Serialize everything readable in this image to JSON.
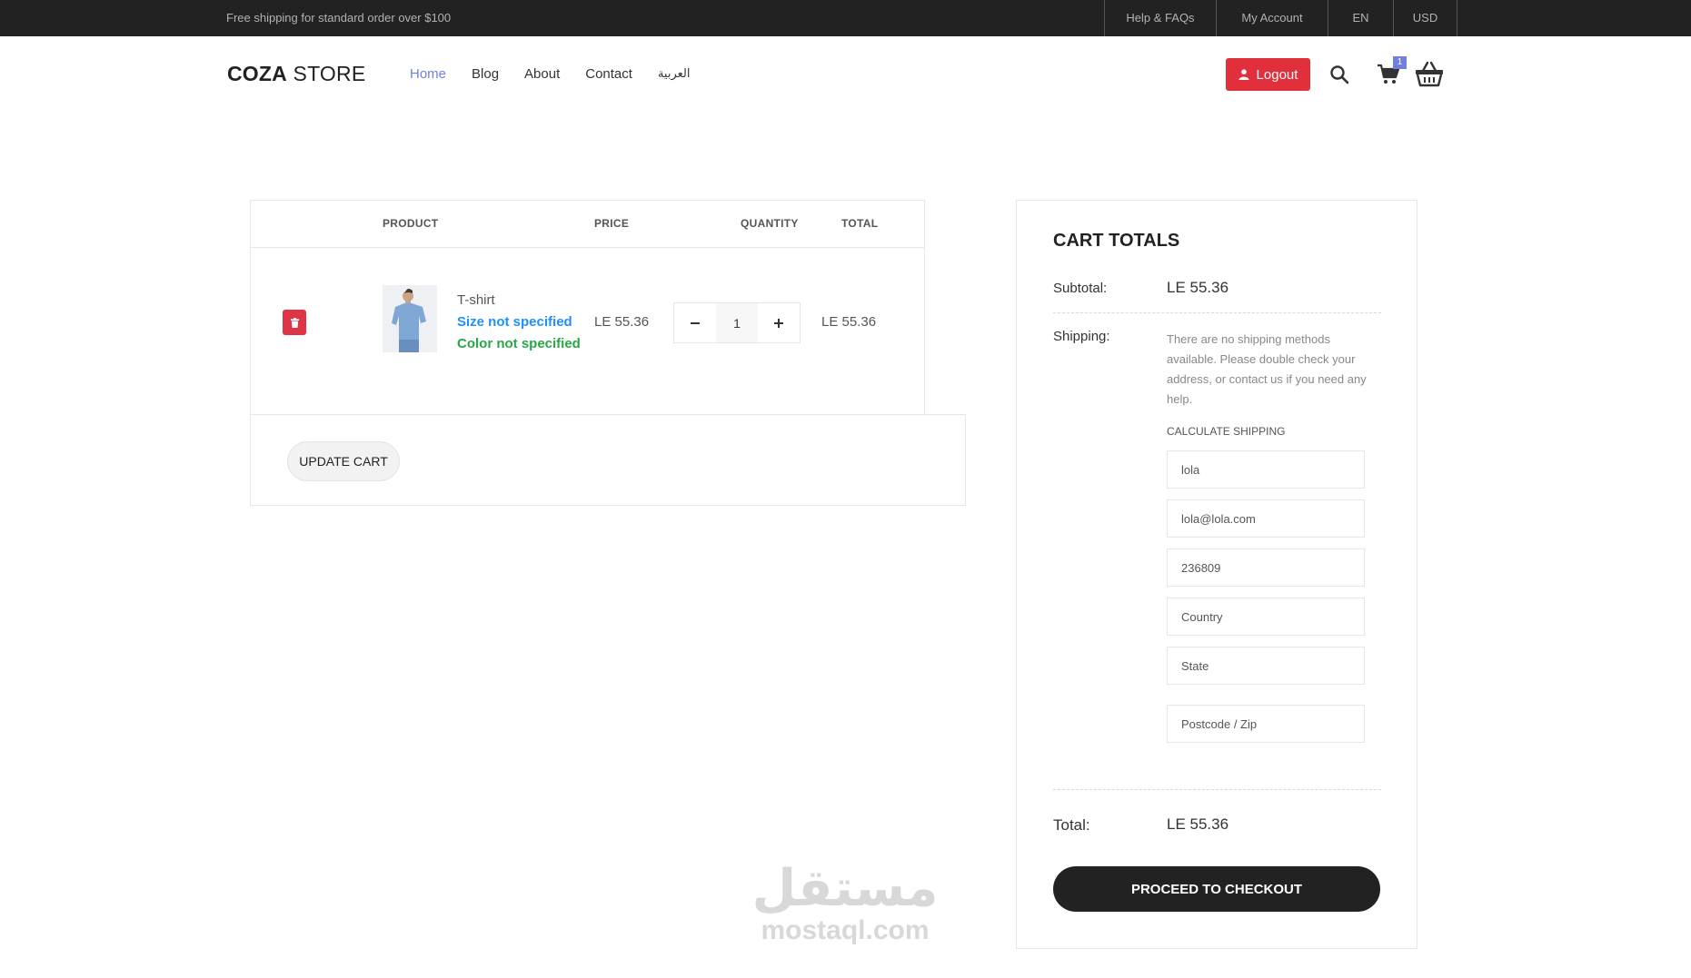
{
  "topbar": {
    "promo": "Free shipping for standard order over $100",
    "links": [
      "Help & FAQs",
      "My Account",
      "EN",
      "USD"
    ]
  },
  "header": {
    "logo_bold": "COZA",
    "logo_light": " STORE",
    "nav": [
      "Home",
      "Blog",
      "About",
      "Contact",
      "العربية"
    ],
    "active_nav": "Home",
    "logout_label": "Logout",
    "cart_count": "1"
  },
  "cart": {
    "headers": {
      "product": "PRODUCT",
      "price": "PRICE",
      "quantity": "QUANTITY",
      "total": "TOTAL"
    },
    "item": {
      "name": "T-shirt",
      "size": "Size not specified",
      "color": "Color not specified",
      "price": "LE 55.36",
      "quantity": "1",
      "total": "LE 55.36"
    },
    "update_label": "UPDATE CART"
  },
  "totals": {
    "title": "CART TOTALS",
    "subtotal_label": "Subtotal:",
    "subtotal_value": "LE 55.36",
    "shipping_label": "Shipping:",
    "shipping_text": "There are no shipping methods available. Please double check your address, or contact us if you need any help.",
    "calc_label": "CALCULATE SHIPPING",
    "fields": {
      "name": "lola",
      "email": "lola@lola.com",
      "phone": "236809",
      "country": "Country",
      "state": "State",
      "postcode": "Postcode / Zip"
    },
    "total_label": "Total:",
    "total_value": "LE 55.36",
    "checkout_label": "PROCEED TO CHECKOUT"
  },
  "watermark": {
    "arabic": "مستقل",
    "latin": "mostaql.com"
  },
  "colors": {
    "accent": "#717fe0",
    "danger": "#e1303c",
    "dark": "#222222",
    "size_text": "#1e90ff",
    "color_text": "#28a745"
  }
}
